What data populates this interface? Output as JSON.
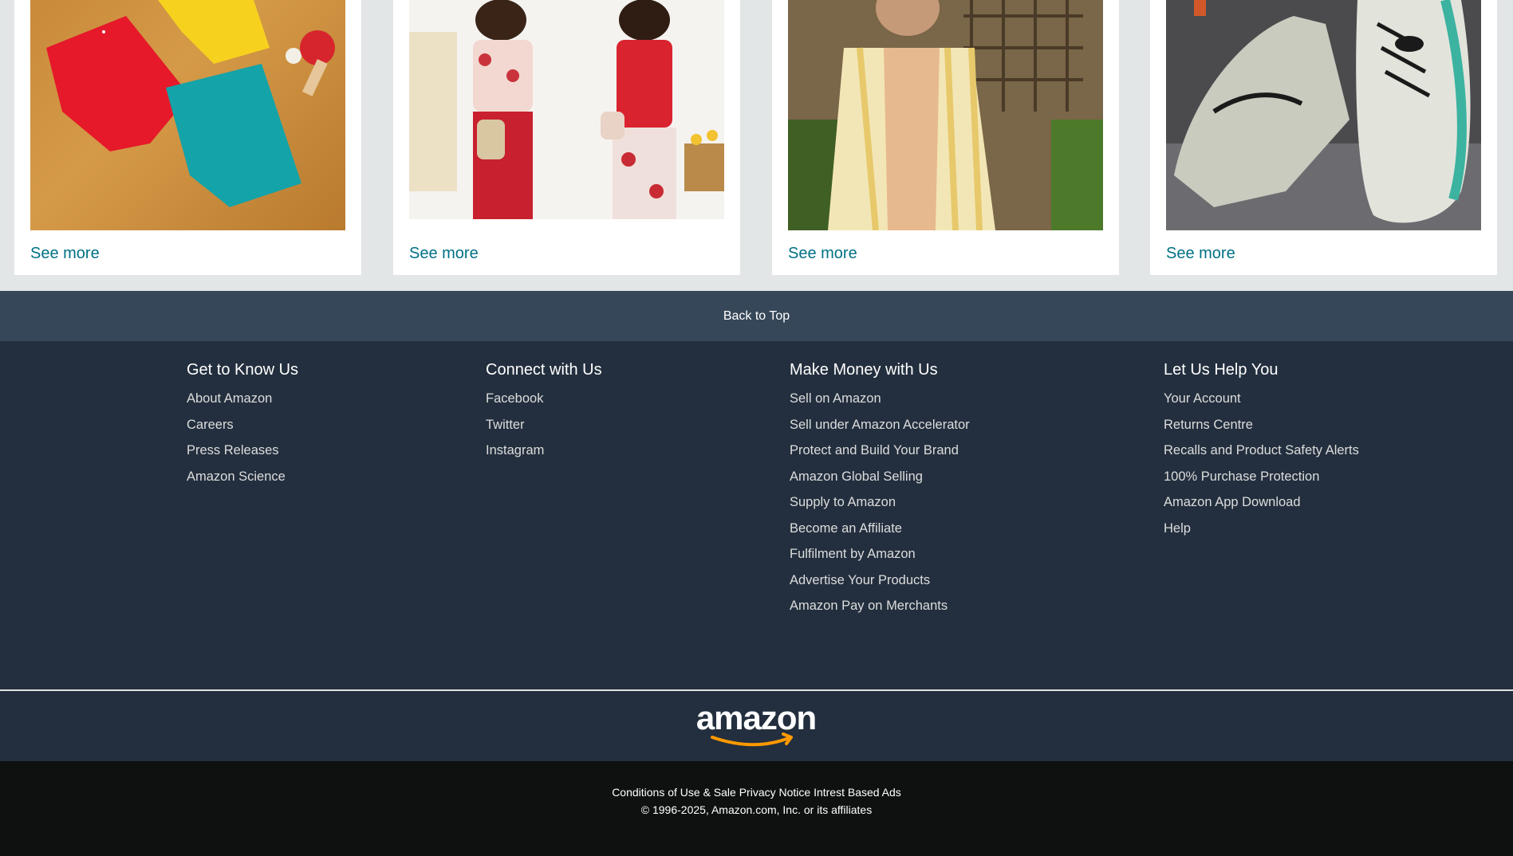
{
  "cards": [
    {
      "see_more": "See more"
    },
    {
      "see_more": "See more"
    },
    {
      "see_more": "See more"
    },
    {
      "see_more": "See more"
    }
  ],
  "back_to_top": "Back to Top",
  "footer": {
    "columns": [
      {
        "title": "Get to Know Us",
        "links": [
          "About Amazon",
          "Careers",
          "Press Releases",
          "Amazon Science"
        ]
      },
      {
        "title": "Connect with Us",
        "links": [
          "Facebook",
          "Twitter",
          "Instagram"
        ]
      },
      {
        "title": "Make Money with Us",
        "links": [
          "Sell on Amazon",
          "Sell under Amazon Accelerator",
          "Protect and Build Your Brand",
          "Amazon Global Selling",
          "Supply to Amazon",
          "Become an Affiliate",
          "Fulfilment by Amazon",
          "Advertise Your Products",
          "Amazon Pay on Merchants"
        ]
      },
      {
        "title": "Let Us Help You",
        "links": [
          "Your Account",
          "Returns Centre",
          "Recalls and Product Safety Alerts",
          "100% Purchase Protection",
          "Amazon App Download",
          "Help"
        ]
      }
    ],
    "logo_text": "amazon",
    "legal_links": [
      "Conditions of Use & Sale",
      "Privacy Notice",
      "Intrest Based Ads"
    ],
    "copyright": "© 1996-2025, Amazon.com, Inc. or its affiliates"
  },
  "colors": {
    "link_teal": "#007185",
    "back_to_top_bg": "#37475a",
    "footer_bg": "#232f3e",
    "bottom_bg": "#0f1111",
    "logo_smile": "#ff9900"
  }
}
